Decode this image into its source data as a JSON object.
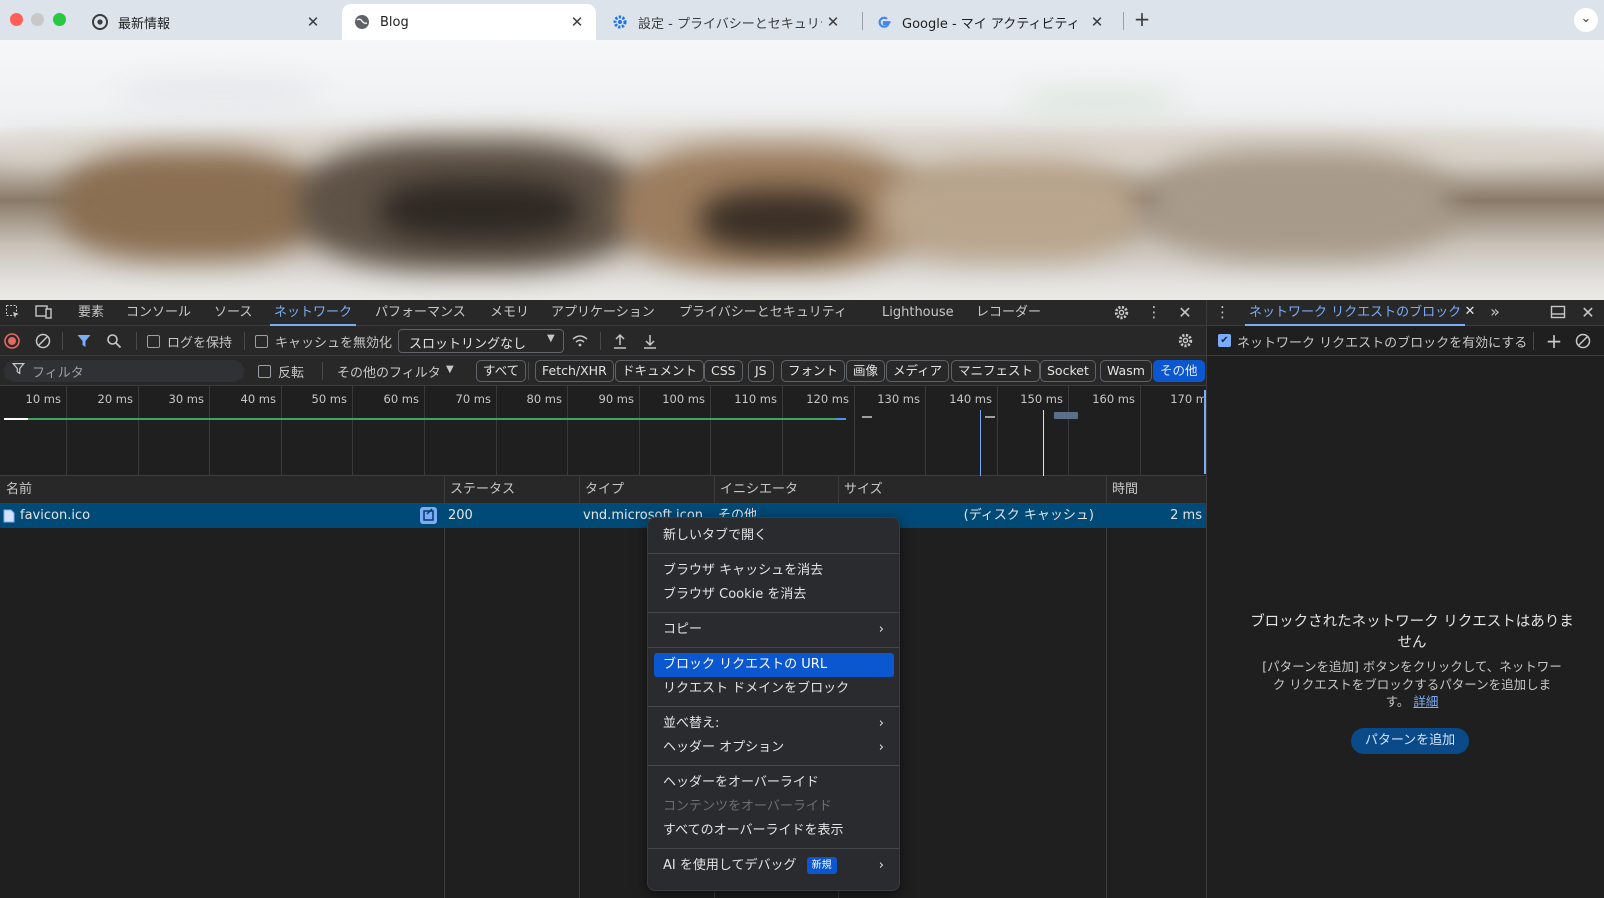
{
  "browser": {
    "tabs": [
      {
        "title": "最新情報",
        "icon": "chrome-icon",
        "active": false
      },
      {
        "title": "Blog",
        "icon": "globe-icon",
        "active": true
      },
      {
        "title": "設定 - プライバシーとセキュリティ",
        "icon": "gear-icon",
        "active": false
      },
      {
        "title": "Google - マイ アクティビティ",
        "icon": "google-icon",
        "active": false
      }
    ],
    "new_tab": "+",
    "tab_search": "⌄"
  },
  "devtools": {
    "panels": [
      "要素",
      "コンソール",
      "ソース",
      "ネットワーク",
      "パフォーマンス",
      "メモリ",
      "アプリケーション",
      "プライバシーとセキュリティ",
      "Lighthouse",
      "レコーダー"
    ],
    "selected_panel": "ネットワーク",
    "network_toolbar": {
      "preserve_log": "ログを保持",
      "disable_cache": "キャッシュを無効化",
      "throttling": "スロットリングなし"
    },
    "filter_bar": {
      "filter_placeholder": "フィルタ",
      "invert": "反転",
      "more_filters": "その他のフィルタ",
      "types": [
        "すべて",
        "Fetch/XHR",
        "ドキュメント",
        "CSS",
        "JS",
        "フォント",
        "画像",
        "メディア",
        "マニフェスト",
        "Socket",
        "Wasm",
        "その他"
      ],
      "selected_type": "その他"
    },
    "timeline_ticks": [
      "10 ms",
      "20 ms",
      "30 ms",
      "40 ms",
      "50 ms",
      "60 ms",
      "70 ms",
      "80 ms",
      "90 ms",
      "100 ms",
      "110 ms",
      "120 ms",
      "130 ms",
      "140 ms",
      "150 ms",
      "160 ms",
      "170 m"
    ],
    "table": {
      "columns": [
        "名前",
        "ステータス",
        "タイプ",
        "イニシエータ",
        "サイズ",
        "時間"
      ],
      "rows": [
        {
          "name": "favicon.ico",
          "status": "200",
          "type": "vnd.microsoft.icon",
          "initiator": "その他",
          "size": "(ディスク キャッシュ)",
          "time": "2 ms"
        }
      ]
    },
    "drawer": {
      "tab_title": "ネットワーク リクエストのブロック",
      "enable_label": "ネットワーク リクエストのブロックを有効にする",
      "empty_title": "ブロックされたネットワーク リクエストはありません",
      "empty_desc": "[パターンを追加] ボタンをクリックして、ネットワーク リクエストをブロックするパターンを追加します。",
      "details_link": "詳細",
      "add_pattern": "パターンを追加"
    }
  },
  "context_menu": {
    "open_new_tab": "新しいタブで開く",
    "clear_cache": "ブラウザ キャッシュを消去",
    "clear_cookies": "ブラウザ Cookie を消去",
    "copy": "コピー",
    "block_url": "ブロック リクエストの URL",
    "block_domain": "リクエスト ドメインをブロック",
    "sort": "並べ替え:",
    "header_options": "ヘッダー オプション",
    "override_headers": "ヘッダーをオーバーライド",
    "override_content": "コンテンツをオーバーライド",
    "show_overrides": "すべてのオーバーライドを表示",
    "ai_debug": "AI を使用してデバッグ",
    "new_badge": "新規",
    "highlighted": "ブロック リクエストの URL"
  },
  "colors": {
    "accent": "#7cacf8",
    "selection": "#004a77",
    "menu_highlight": "#0b57d0"
  }
}
